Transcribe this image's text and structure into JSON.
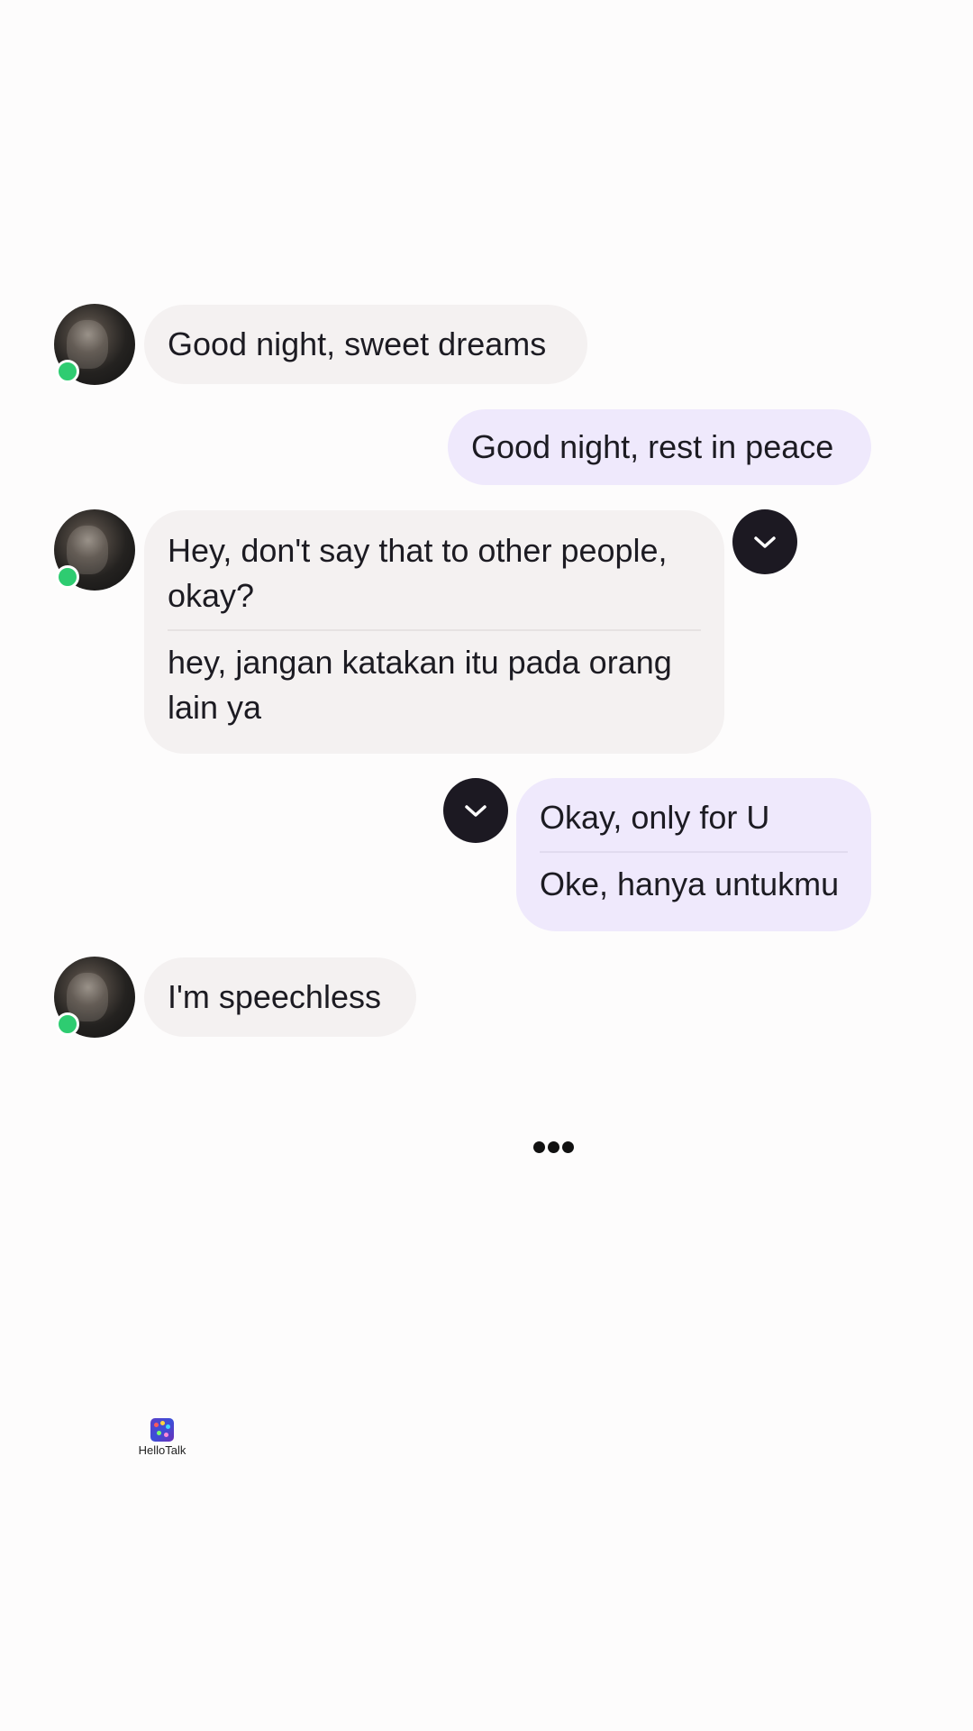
{
  "messages": [
    {
      "id": "m1",
      "direction": "incoming",
      "text": "Good night, sweet dreams"
    },
    {
      "id": "m2",
      "direction": "outgoing",
      "text": "Good night, rest in peace"
    },
    {
      "id": "m3",
      "direction": "incoming",
      "text": "Hey, don't say that to other people, okay?",
      "translation": "hey, jangan katakan itu pada orang lain ya"
    },
    {
      "id": "m4",
      "direction": "outgoing",
      "text": "Okay, only for U",
      "translation": "Oke, hanya untukmu"
    },
    {
      "id": "m5",
      "direction": "incoming",
      "text": "I'm speechless"
    }
  ],
  "contact": {
    "status": "online",
    "status_color": "#2ecc71"
  },
  "icons": {
    "message_options": "chevron-down-icon",
    "typing": "typing-indicator-icon"
  },
  "colors": {
    "incoming_bubble": "#f4f1f1",
    "outgoing_bubble": "#efe9fc",
    "options_button": "#1c1922"
  },
  "watermark": {
    "text": "HelloTalk"
  }
}
